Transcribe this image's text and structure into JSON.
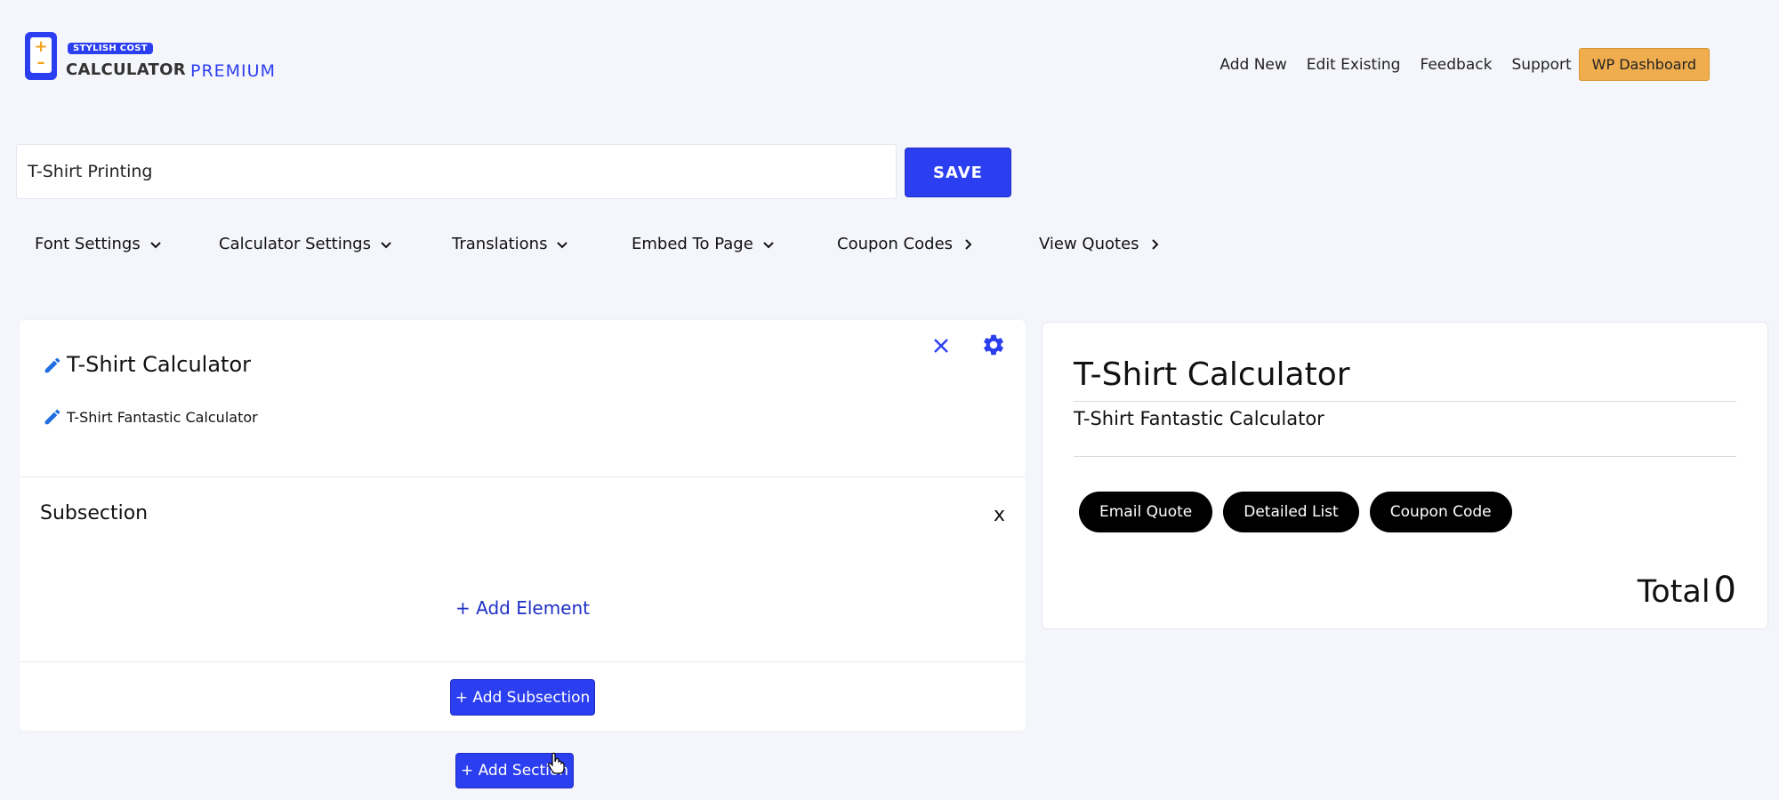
{
  "logo": {
    "badge": "STYLISH COST",
    "main": "CALCULATOR",
    "tier": "PREMIUM"
  },
  "topnav": {
    "items": [
      "Add New",
      "Edit Existing",
      "Feedback",
      "Support"
    ],
    "wp_dashboard": "WP Dashboard"
  },
  "calculator_name": {
    "value": "T-Shirt Printing"
  },
  "save_label": "SAVE",
  "menu": {
    "items": [
      {
        "label": "Font Settings",
        "icon": "chevron-down-icon"
      },
      {
        "label": "Calculator Settings",
        "icon": "chevron-down-icon"
      },
      {
        "label": "Translations",
        "icon": "chevron-down-icon"
      },
      {
        "label": "Embed To Page",
        "icon": "chevron-down-icon"
      },
      {
        "label": "Coupon Codes",
        "icon": "chevron-right-icon"
      },
      {
        "label": "View Quotes",
        "icon": "chevron-right-icon"
      }
    ]
  },
  "editor": {
    "title": "T-Shirt Calculator",
    "subtitle": "T-Shirt Fantastic Calculator",
    "subsection_title": "Subsection",
    "subsection_close": "x",
    "add_element": "+ Add Element",
    "add_subsection": "+ Add Subsection",
    "add_section": "+ Add Section"
  },
  "preview": {
    "title": "T-Shirt Calculator",
    "subtitle": "T-Shirt Fantastic Calculator",
    "buttons": [
      "Email Quote",
      "Detailed List",
      "Coupon Code"
    ],
    "total_label": "Total",
    "total_value": "0"
  },
  "colors": {
    "accent": "#2c3ff0",
    "wp_button": "#f0ad4e",
    "page_bg": "#f5f6fb"
  }
}
